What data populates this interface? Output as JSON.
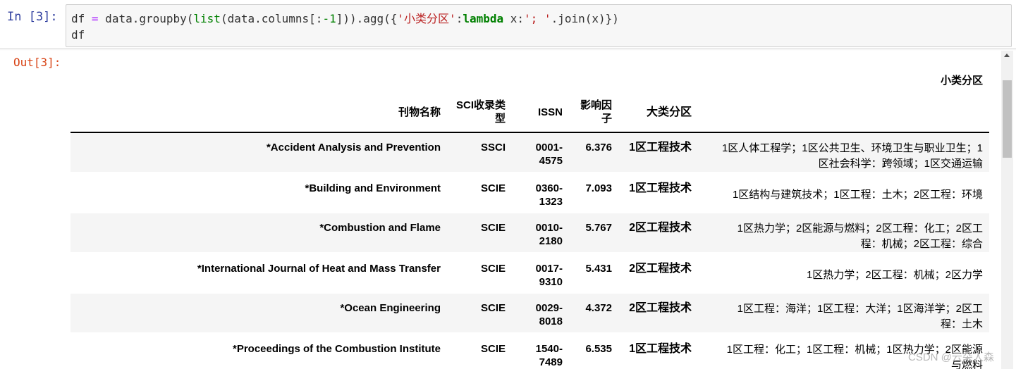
{
  "input_cell": {
    "prompt": "In  [3]:",
    "code_line1": {
      "p1": "df ",
      "op1": "=",
      "p2": " data.groupby(",
      "builtin": "list",
      "p3": "(data.columns[:",
      "num": "-1",
      "p4": "])).agg({",
      "str1": "'小类分区'",
      "p5": ":",
      "kw": "lambda",
      "p6": " x:",
      "str2": "'; '",
      "p7": ".join(x)})"
    },
    "code_line2": "df"
  },
  "output_cell": {
    "prompt": "Out[3]:",
    "column_caption": "小类分区",
    "headers": {
      "name": "刊物名称",
      "sci_type_1": "SCI收录类",
      "sci_type_2": "型",
      "issn": "ISSN",
      "impact_1": "影响因",
      "impact_2": "子",
      "big_zone": "大类分区"
    },
    "rows": [
      {
        "name": "*Accident Analysis and Prevention",
        "type": "SSCI",
        "issn_1": "0001-",
        "issn_2": "4575",
        "impact": "6.376",
        "big": "1区工程技术",
        "small_1": "1区人体工程学；1区公共卫生、环境卫生与职业卫生；1",
        "small_2": "区社会科学：跨领域；1区交通运输"
      },
      {
        "name": "*Building and Environment",
        "type": "SCIE",
        "issn_1": "0360-",
        "issn_2": "1323",
        "impact": "7.093",
        "big": "1区工程技术",
        "small_1": "1区结构与建筑技术；1区工程：土木；2区工程：环境",
        "small_2": ""
      },
      {
        "name": "*Combustion and Flame",
        "type": "SCIE",
        "issn_1": "0010-",
        "issn_2": "2180",
        "impact": "5.767",
        "big": "2区工程技术",
        "small_1": "1区热力学；2区能源与燃料；2区工程：化工；2区工",
        "small_2": "程：机械；2区工程：综合"
      },
      {
        "name": "*International Journal of Heat and Mass Transfer",
        "type": "SCIE",
        "issn_1": "0017-",
        "issn_2": "9310",
        "impact": "5.431",
        "big": "2区工程技术",
        "small_1": "1区热力学；2区工程：机械；2区力学",
        "small_2": ""
      },
      {
        "name": "*Ocean Engineering",
        "type": "SCIE",
        "issn_1": "0029-",
        "issn_2": "8018",
        "impact": "4.372",
        "big": "2区工程技术",
        "small_1": "1区工程：海洋；1区工程：大洋；1区海洋学；2区工",
        "small_2": "程：土木"
      },
      {
        "name": "*Proceedings of the Combustion Institute",
        "type": "SCIE",
        "issn_1": "1540-",
        "issn_2": "7489",
        "impact": "6.535",
        "big": "1区工程技术",
        "small_1": "1区工程：化工；1区工程：机械；1区热力学；2区能源",
        "small_2": "与燃料"
      }
    ]
  },
  "watermark": "CSDN @云朵人森",
  "icons": {
    "scroll_up": "triangle-up-icon"
  }
}
